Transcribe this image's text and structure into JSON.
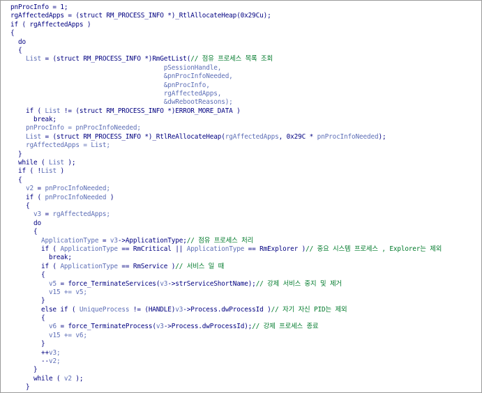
{
  "code_view": {
    "lines": [
      [
        {
          "t": "pnProcInfo = 1;",
          "c": "v"
        }
      ],
      [
        {
          "t": "rgAffectedApps = (struct RM_PROCESS_INFO *)",
          "c": "v"
        },
        {
          "t": "_RtlAllocateHeap",
          "c": "f"
        },
        {
          "t": "(0x29Cu);",
          "c": "v"
        }
      ],
      [
        {
          "t": "if ( ",
          "c": "k"
        },
        {
          "t": "rgAffectedApps",
          "c": "v"
        },
        {
          "t": " )",
          "c": "v"
        }
      ],
      [
        {
          "t": "{",
          "c": "v"
        }
      ],
      [
        {
          "t": "  do",
          "c": "k"
        }
      ],
      [
        {
          "t": "  {",
          "c": "v"
        }
      ],
      [
        {
          "t": "    ",
          "c": "v"
        },
        {
          "t": "List",
          "c": "l"
        },
        {
          "t": " = (struct RM_PROCESS_INFO *)",
          "c": "v"
        },
        {
          "t": "RmGetList",
          "c": "f"
        },
        {
          "t": "(",
          "c": "v"
        },
        {
          "t": "// 점유 프로세스 목록 조회",
          "c": "c"
        }
      ],
      [
        {
          "t": "                                        ",
          "c": "v"
        },
        {
          "t": "pSessionHandle,",
          "c": "l"
        }
      ],
      [
        {
          "t": "                                        ",
          "c": "v"
        },
        {
          "t": "&pnProcInfoNeeded,",
          "c": "l"
        }
      ],
      [
        {
          "t": "                                        ",
          "c": "v"
        },
        {
          "t": "&pnProcInfo,",
          "c": "l"
        }
      ],
      [
        {
          "t": "                                        ",
          "c": "v"
        },
        {
          "t": "rgAffectedApps,",
          "c": "l"
        }
      ],
      [
        {
          "t": "                                        ",
          "c": "v"
        },
        {
          "t": "&dwRebootReasons);",
          "c": "l"
        }
      ],
      [
        {
          "t": "    if ( ",
          "c": "k"
        },
        {
          "t": "List",
          "c": "l"
        },
        {
          "t": " != (struct RM_PROCESS_INFO *)ERROR_MORE_DATA )",
          "c": "v"
        }
      ],
      [
        {
          "t": "      break;",
          "c": "k"
        }
      ],
      [
        {
          "t": "    ",
          "c": "v"
        },
        {
          "t": "pnProcInfo = pnProcInfoNeeded;",
          "c": "l"
        }
      ],
      [
        {
          "t": "    ",
          "c": "v"
        },
        {
          "t": "List",
          "c": "l"
        },
        {
          "t": " = (struct RM_PROCESS_INFO *)",
          "c": "v"
        },
        {
          "t": "_RtlReAllocateHeap",
          "c": "f"
        },
        {
          "t": "(",
          "c": "v"
        },
        {
          "t": "rgAffectedApps",
          "c": "l"
        },
        {
          "t": ", 0x29C * ",
          "c": "v"
        },
        {
          "t": "pnProcInfoNeeded",
          "c": "l"
        },
        {
          "t": ");",
          "c": "v"
        }
      ],
      [
        {
          "t": "    ",
          "c": "v"
        },
        {
          "t": "rgAffectedApps = List;",
          "c": "l"
        }
      ],
      [
        {
          "t": "  }",
          "c": "v"
        }
      ],
      [
        {
          "t": "  while ( ",
          "c": "k"
        },
        {
          "t": "List",
          "c": "l"
        },
        {
          "t": " );",
          "c": "v"
        }
      ],
      [
        {
          "t": "  if ( !",
          "c": "k"
        },
        {
          "t": "List",
          "c": "l"
        },
        {
          "t": " )",
          "c": "v"
        }
      ],
      [
        {
          "t": "  {",
          "c": "v"
        }
      ],
      [
        {
          "t": "    ",
          "c": "v"
        },
        {
          "t": "v2",
          "c": "l"
        },
        {
          "t": " = ",
          "c": "v"
        },
        {
          "t": "pnProcInfoNeeded;",
          "c": "l"
        }
      ],
      [
        {
          "t": "    if ( ",
          "c": "k"
        },
        {
          "t": "pnProcInfoNeeded",
          "c": "l"
        },
        {
          "t": " )",
          "c": "v"
        }
      ],
      [
        {
          "t": "    {",
          "c": "v"
        }
      ],
      [
        {
          "t": "      ",
          "c": "v"
        },
        {
          "t": "v3",
          "c": "l"
        },
        {
          "t": " = ",
          "c": "v"
        },
        {
          "t": "rgAffectedApps;",
          "c": "l"
        }
      ],
      [
        {
          "t": "      do",
          "c": "k"
        }
      ],
      [
        {
          "t": "      {",
          "c": "v"
        }
      ],
      [
        {
          "t": "        ",
          "c": "v"
        },
        {
          "t": "ApplicationType",
          "c": "l"
        },
        {
          "t": " = ",
          "c": "v"
        },
        {
          "t": "v3",
          "c": "l"
        },
        {
          "t": "->ApplicationType;",
          "c": "v"
        },
        {
          "t": "// 점유 프로세스 처리",
          "c": "c"
        }
      ],
      [
        {
          "t": "        if ( ",
          "c": "k"
        },
        {
          "t": "ApplicationType",
          "c": "l"
        },
        {
          "t": " == RmCritical || ",
          "c": "v"
        },
        {
          "t": "ApplicationType",
          "c": "l"
        },
        {
          "t": " == RmExplorer )",
          "c": "v"
        },
        {
          "t": "// 중요 시스템 프로세스 , Explorer는 제외",
          "c": "c"
        }
      ],
      [
        {
          "t": "          break;",
          "c": "k"
        }
      ],
      [
        {
          "t": "        if ( ",
          "c": "k"
        },
        {
          "t": "ApplicationType",
          "c": "l"
        },
        {
          "t": " == RmService )",
          "c": "v"
        },
        {
          "t": "// 서비스 일 때",
          "c": "c"
        }
      ],
      [
        {
          "t": "        {",
          "c": "v"
        }
      ],
      [
        {
          "t": "          ",
          "c": "v"
        },
        {
          "t": "v5",
          "c": "l"
        },
        {
          "t": " = ",
          "c": "v"
        },
        {
          "t": "force_TerminateServices",
          "c": "f"
        },
        {
          "t": "(",
          "c": "v"
        },
        {
          "t": "v3",
          "c": "l"
        },
        {
          "t": "->strServiceShortName);",
          "c": "v"
        },
        {
          "t": "// 강제 서비스 중지 및 제거",
          "c": "c"
        }
      ],
      [
        {
          "t": "          ",
          "c": "v"
        },
        {
          "t": "v15 += v5;",
          "c": "l"
        }
      ],
      [
        {
          "t": "        }",
          "c": "v"
        }
      ],
      [
        {
          "t": "        else if ( ",
          "c": "k"
        },
        {
          "t": "UniqueProcess",
          "c": "l"
        },
        {
          "t": " != (HANDLE)",
          "c": "v"
        },
        {
          "t": "v3",
          "c": "l"
        },
        {
          "t": "->Process.dwProcessId )",
          "c": "v"
        },
        {
          "t": "// 자기 자신 PID는 제외",
          "c": "c"
        }
      ],
      [
        {
          "t": "        {",
          "c": "v"
        }
      ],
      [
        {
          "t": "          ",
          "c": "v"
        },
        {
          "t": "v6",
          "c": "l"
        },
        {
          "t": " = ",
          "c": "v"
        },
        {
          "t": "force_TerminateProcess",
          "c": "f"
        },
        {
          "t": "(",
          "c": "v"
        },
        {
          "t": "v3",
          "c": "l"
        },
        {
          "t": "->Process.dwProcessId);",
          "c": "v"
        },
        {
          "t": "// 강제 프로세스 종료",
          "c": "c"
        }
      ],
      [
        {
          "t": "          ",
          "c": "v"
        },
        {
          "t": "v15 += v6;",
          "c": "l"
        }
      ],
      [
        {
          "t": "        }",
          "c": "v"
        }
      ],
      [
        {
          "t": "        ++",
          "c": "v"
        },
        {
          "t": "v3;",
          "c": "l"
        }
      ],
      [
        {
          "t": "        --",
          "c": "v"
        },
        {
          "t": "v2;",
          "c": "l"
        }
      ],
      [
        {
          "t": "      }",
          "c": "v"
        }
      ],
      [
        {
          "t": "      while ( ",
          "c": "k"
        },
        {
          "t": "v2",
          "c": "l"
        },
        {
          "t": " );",
          "c": "v"
        }
      ],
      [
        {
          "t": "    }",
          "c": "v"
        }
      ],
      [
        {
          "t": "  }",
          "c": "v"
        }
      ]
    ]
  }
}
